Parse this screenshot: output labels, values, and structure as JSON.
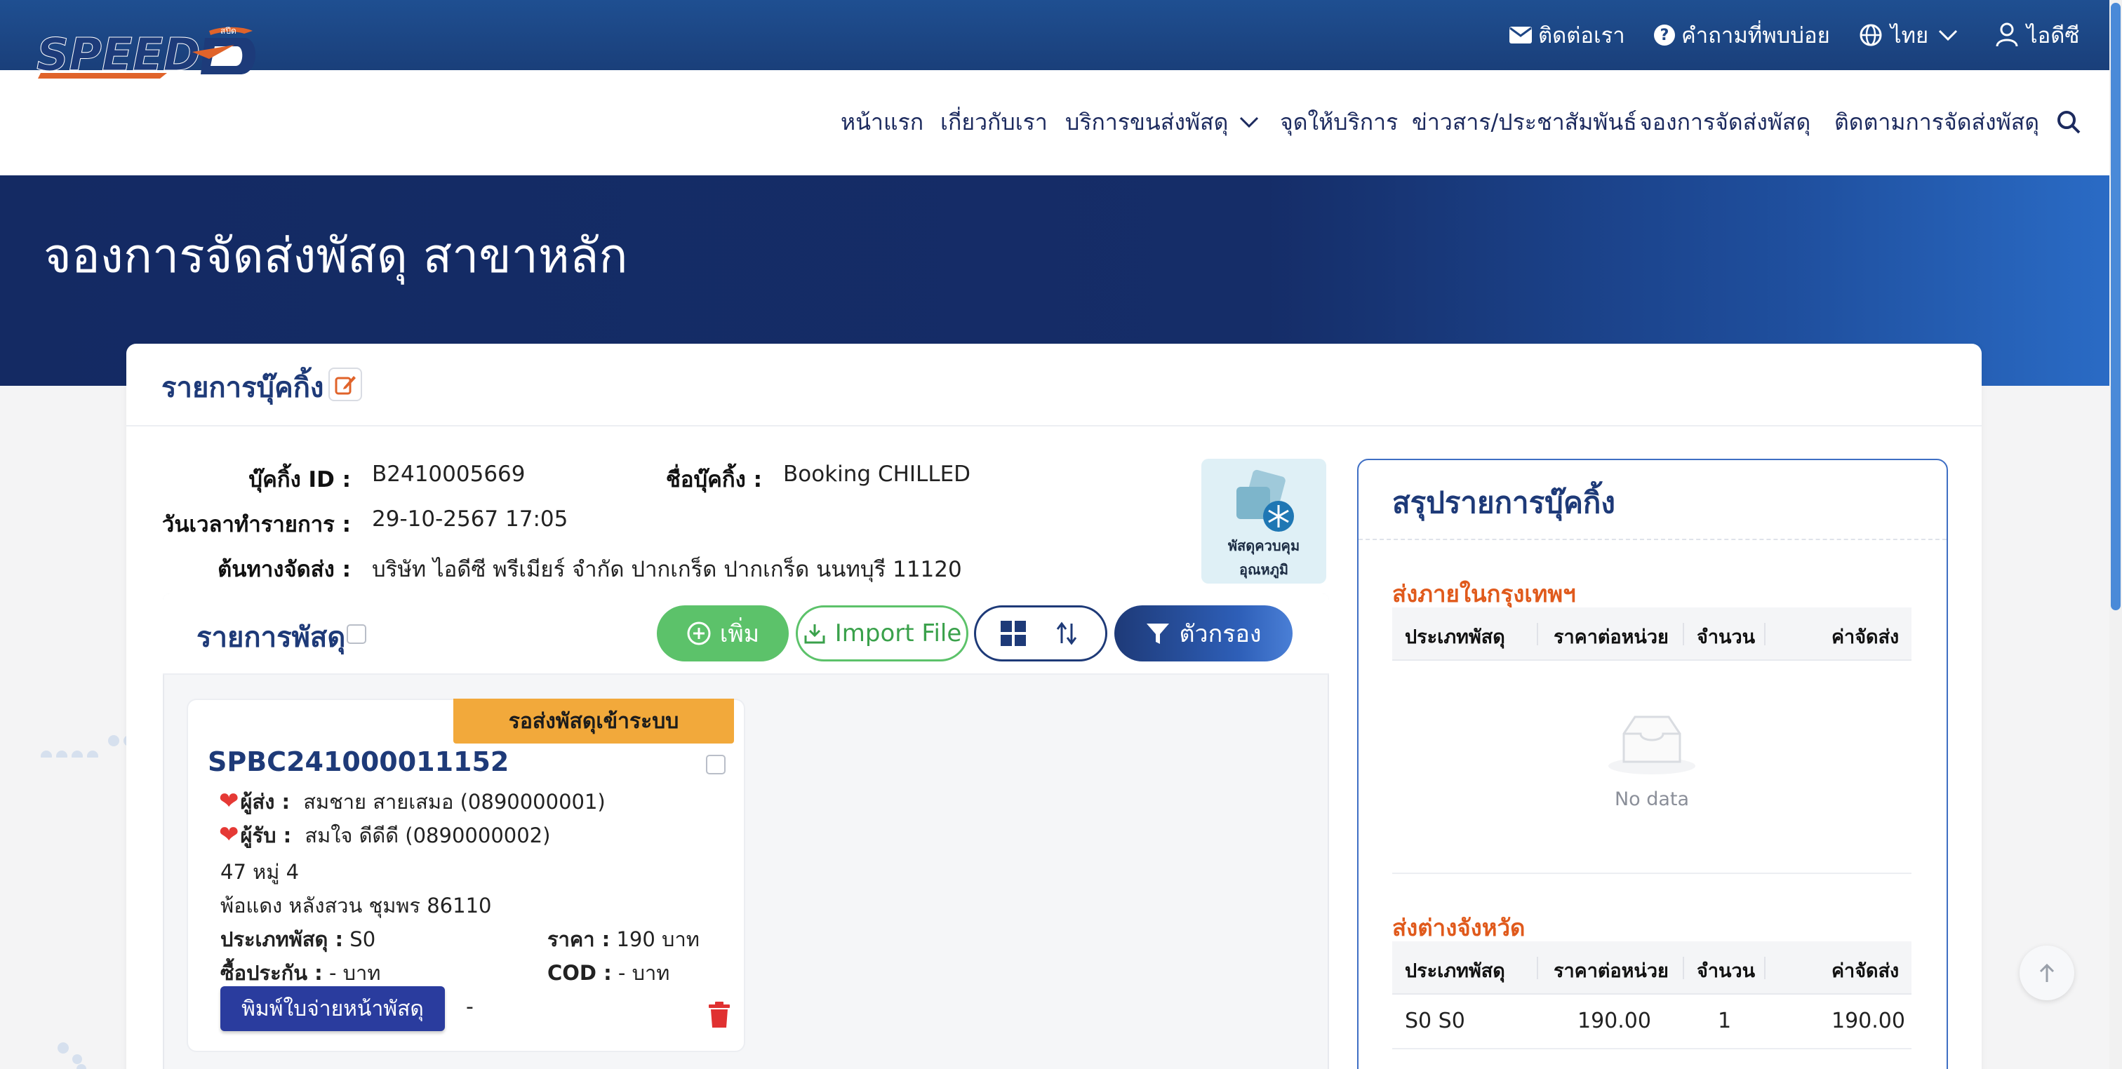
{
  "topbar": {
    "contact": "ติดต่อเรา",
    "faq": "คำถามที่พบบ่อย",
    "language": "ไทย",
    "user": "ไอดีซี"
  },
  "logo": {
    "text": "SPEED-D",
    "badge": "สปีด"
  },
  "nav": {
    "items": [
      "หน้าแรก",
      "เกี่ยวกับเรา",
      "บริการขนส่งพัสดุ",
      "จุดให้บริการ",
      "ข่าวสาร/ประชาสัมพันธ์",
      "จองการจัดส่งพัสดุ",
      "ติดตามการจัดส่งพัสดุ"
    ]
  },
  "hero": {
    "title": "จองการจัดส่งพัสดุ สาขาหลัก"
  },
  "booking": {
    "section_title": "รายการบุ๊คกิ้ง",
    "id_label": "บุ๊คกิ้ง ID :",
    "id_value": "B2410005669",
    "name_label": "ชื่อบุ๊คกิ้ง :",
    "name_value": "Booking CHILLED",
    "datetime_label": "วันเวลาทำรายการ :",
    "datetime_value": "29-10-2567 17:05",
    "origin_label": "ต้นทางจัดส่ง :",
    "origin_value": "บริษัท ไอดีซี พรีเมียร์ จำกัด ปากเกร็ด ปากเกร็ด นนทบุรี 11120",
    "chilled_line1": "พัสดุควบคุม",
    "chilled_line2": "อุณหภูมิ"
  },
  "parcels": {
    "title": "รายการพัสดุ",
    "add_button": "เพิ่ม",
    "import_button": "Import File",
    "filter_button": "ตัวกรอง",
    "items": [
      {
        "status": "รอส่งพัสดุเข้าระบบ",
        "tracking": "SPBC241000011152",
        "sender_label": "ผู้ส่ง :",
        "sender": "สมชาย สายเสมอ  (0890000001)",
        "receiver_label": "ผู้รับ :",
        "receiver": "สมใจ ดีดีดี  (0890000002)",
        "address1": "47 หมู่ 4",
        "address2": "พ้อแดง หลังสวน ชุมพร 86110",
        "type_label": "ประเภทพัสดุ :",
        "type_value": " S0",
        "price_label": "ราคา :",
        "price_value": " 190 บาท",
        "insurance_label": "ซื้อประกัน :",
        "insurance_value": " - บาท",
        "cod_label": "COD :",
        "cod_value": " - บาท",
        "print_button": "พิมพ์ใบจ่ายหน้าพัสดุ",
        "extra": "-"
      }
    ]
  },
  "summary": {
    "title": "สรุปรายการบุ๊คกิ้ง",
    "columns": [
      "ประเภทพัสดุ",
      "ราคาต่อหน่วย",
      "จำนวน",
      "ค่าจัดส่ง"
    ],
    "bangkok": {
      "title": "ส่งภายในกรุงเทพฯ",
      "empty_text": "No data",
      "rows": []
    },
    "upcountry": {
      "title": "ส่งต่างจังหวัด",
      "rows": [
        {
          "type": "S0 S0",
          "unit_price": "190.00",
          "qty": "1",
          "fee": "190.00"
        }
      ]
    }
  }
}
